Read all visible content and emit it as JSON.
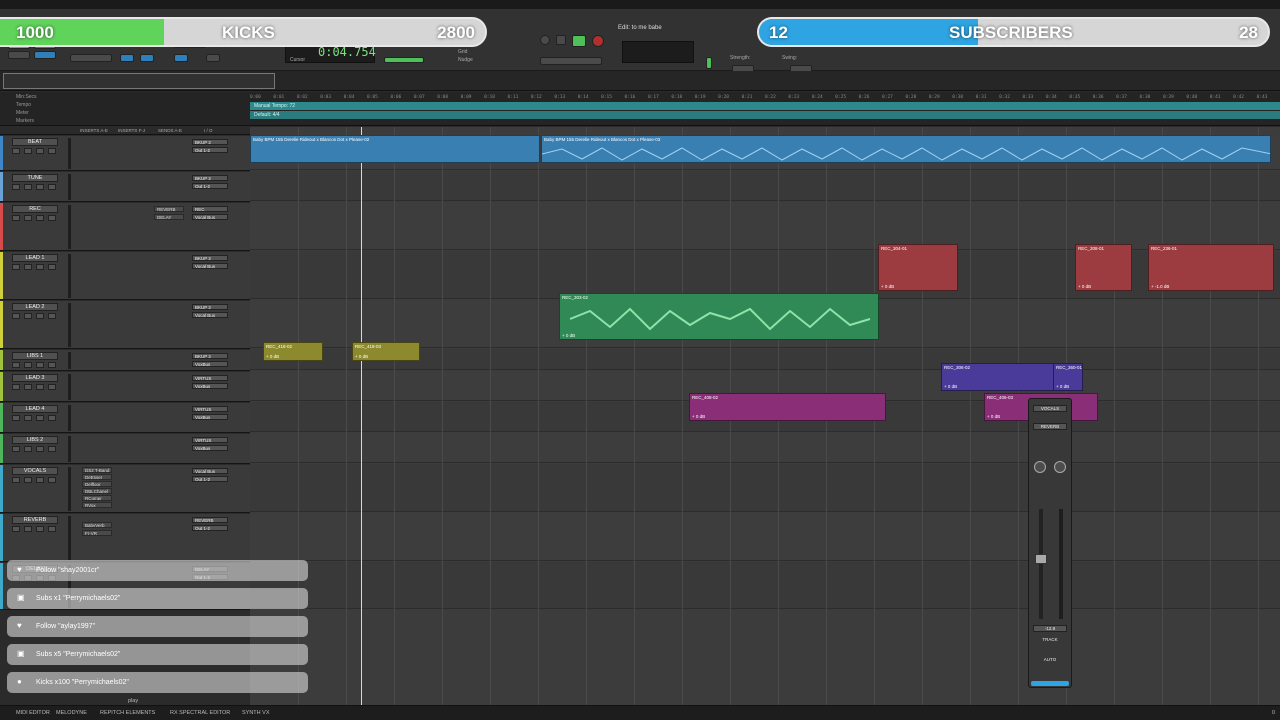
{
  "overlay": {
    "kicks_count": "1000",
    "kicks_label": "KICKS",
    "kicks_goal": "2800",
    "kicks_progress": 0.36,
    "subs_count": "12",
    "subs_label": "SUBSCRIBERS",
    "subs_goal": "28",
    "subs_progress": 0.43
  },
  "toolbar": {
    "counter": "0:04.754",
    "doc_title": "Edit: to me babe",
    "cursor_label": "Cursor",
    "grid_label": "Grid",
    "nudge_label": "Nudge",
    "strength_label": "Strength:",
    "swing_label": "Swing:"
  },
  "rulers": {
    "min_secs": "Min:Secs",
    "tempo": "Tempo",
    "meter": "Meter",
    "markers": "Markers",
    "tempo_value": "Manual Tempo: 72",
    "meter_value": "Default: 4/4",
    "ticks": [
      "0:00",
      "0:01",
      "0:02",
      "0:03",
      "0:04",
      "0:05",
      "0:06",
      "0:07",
      "0:08",
      "0:09",
      "0:10",
      "0:11",
      "0:12",
      "0:13",
      "0:14",
      "0:15",
      "0:16",
      "0:17",
      "0:18",
      "0:19",
      "0:20",
      "0:21",
      "0:22",
      "0:23",
      "0:24",
      "0:25",
      "0:26",
      "0:27",
      "0:28",
      "0:29",
      "0:30",
      "0:31",
      "0:32",
      "0:33",
      "0:34",
      "0:35",
      "0:36",
      "0:37",
      "0:38",
      "0:39",
      "0:40",
      "0:41",
      "0:42",
      "0:43"
    ]
  },
  "column_headers": {
    "inserts_ae": "INSERTS A-E",
    "inserts_fj": "INSERTS F-J",
    "sends_ae": "SENDS A-E",
    "io": "I / O"
  },
  "tracks": [
    {
      "name": "BEAT",
      "color": "#3f86c8",
      "io_in": "BKUP 2",
      "io_out": "Out 1-2"
    },
    {
      "name": "TUNE",
      "color": "#6aa2d6",
      "io_in": "BKUP 2",
      "io_out": "Out 1-2"
    },
    {
      "name": "REC",
      "color": "#d94b4b",
      "io_in": "REC",
      "io_out": "Vocal Bus"
    },
    {
      "name": "LEAD 1",
      "color": "#cfcf3a",
      "io_in": "BKUP 2",
      "io_out": "Vocal Bus"
    },
    {
      "name": "LEAD 2",
      "color": "#cfcf3a",
      "io_in": "BKUP 2",
      "io_out": "Vocal Bus"
    },
    {
      "name": "LIBS 1",
      "color": "#9fc43c",
      "io_in": "BKUP 2",
      "io_out": "VoxBus"
    },
    {
      "name": "LEAD 3",
      "color": "#9fc43c",
      "io_in": "VIRTUS",
      "io_out": "VoxBus"
    },
    {
      "name": "LEAD 4",
      "color": "#4fb55a",
      "io_in": "VIRTUS",
      "io_out": "VoxBus"
    },
    {
      "name": "LIBS 2",
      "color": "#4fb55a",
      "io_in": "VIRTUS",
      "io_out": "VoxBus"
    },
    {
      "name": "VOCALS",
      "color": "#3fa9c9",
      "io_in": "Vocal Bus",
      "io_out": "Out 1-2"
    },
    {
      "name": "REVERB",
      "color": "#3fa9c9",
      "io_in": "REVERB",
      "io_out": "Out 1-2"
    },
    {
      "name": "DELAY",
      "color": "#3fa9c9",
      "io_in": "DELAY",
      "io_out": "Out 1-2"
    }
  ],
  "track_inserts": {
    "rec_sends": [
      "REVERB",
      "DELAY"
    ],
    "vocals_inserts": [
      "DS2 T-Band",
      "DeEsser",
      "Delfloor",
      "DBLChanel",
      "RCompr",
      "RVox"
    ],
    "reverb_inserts": [
      "BabyVerb",
      "Fr-VR"
    ]
  },
  "clips": {
    "beat_a": "Baby BPM 155 Derelie Rideout x Blancos Dot x Please-02",
    "beat_b": "Baby BPM 155 Derelie Rideout x Blancos Dot x Please-03",
    "lead1_a": "REC_304-01",
    "lead1_b": "REC_308-01",
    "lead1_c": "REC_236-01",
    "lead2_a": "REC_303-02",
    "libs1_a": "REC_418-02",
    "libs1_b": "REC_418-03",
    "lead3_a": "REC_306-02",
    "lead3_b": "REC_360-01",
    "lead4_a": "REC_408-02",
    "lead4_b": "REC_406-03",
    "gain_0": "+ 0 dB",
    "gain_m1": "+ -1.0 dB"
  },
  "minimix": {
    "track": "VOCALS",
    "insert": "REVERB",
    "level": "-12.9",
    "track_label": "TRACK",
    "auto_label": "AUTO"
  },
  "alerts": [
    {
      "icon": "heart-icon",
      "glyph": "♥",
      "text": "Follow \"shay2001cr\""
    },
    {
      "icon": "gift-icon",
      "glyph": "▣",
      "text": "Subs x1 \"Perrymichaels02\""
    },
    {
      "icon": "heart-icon",
      "glyph": "♥",
      "text": "Follow \"aylay1997\""
    },
    {
      "icon": "gift-icon",
      "glyph": "▣",
      "text": "Subs x5 \"Perrymichaels02\""
    },
    {
      "icon": "kick-icon",
      "glyph": "●",
      "text": "Kicks x100 \"Perrymichaels02\""
    }
  ],
  "statusbar": {
    "midi": "MIDI EDITOR",
    "melodyne": "MELODYNE",
    "repitch": "REPITCH ELEMENTS",
    "spectral": "RX SPECTRAL EDITOR",
    "synth": "SYNTH VX",
    "page": "0",
    "play": "play"
  },
  "colors": {
    "kicks": "#5fd35a",
    "subs": "#2ea4e3",
    "tempo_ruler": "#2d8a8c",
    "beat_clip": "#3a7fb1",
    "lead2_clip": "#2f8a55",
    "lead1_clip": "#9c3c40",
    "libs_clip": "#8d8a2e",
    "lead3_clip": "#4a3a9a",
    "lead4_clip": "#8a2e78"
  }
}
